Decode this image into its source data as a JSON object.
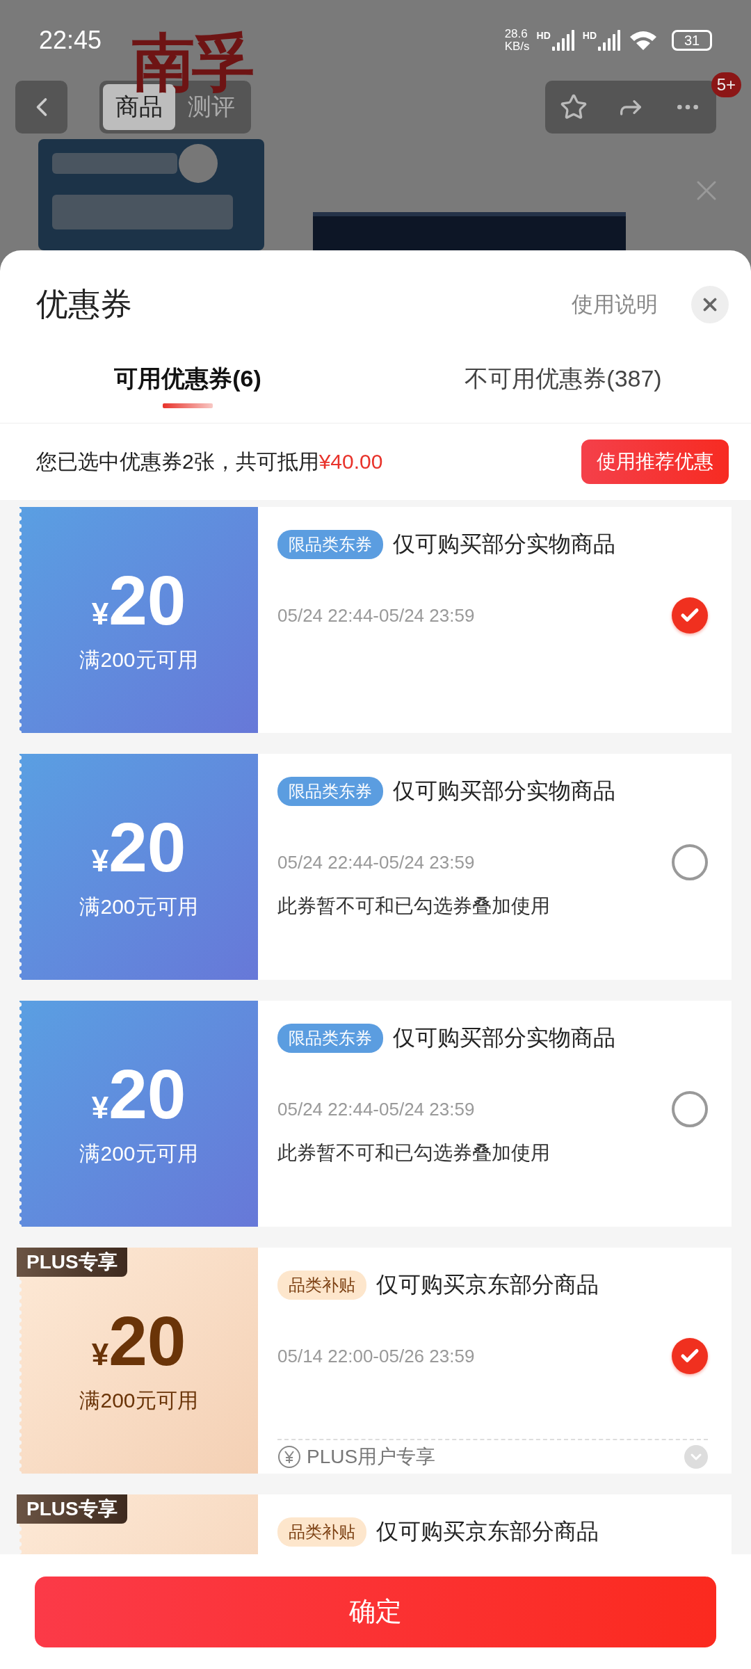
{
  "status_bar": {
    "time": "22:45",
    "net_speed": "28.6",
    "net_unit": "KB/s",
    "sim1": "HD",
    "sim2": "HD",
    "battery": "31"
  },
  "background_page": {
    "logo": "南孚",
    "tabs": [
      {
        "label": "商品",
        "selected": true
      },
      {
        "label": "测评",
        "selected": false
      }
    ],
    "badge": "5+"
  },
  "sheet": {
    "title": "优惠券",
    "help_link": "使用说明",
    "tabs": [
      {
        "label": "可用优惠券(6)",
        "selected": true
      },
      {
        "label": "不可用优惠券(387)",
        "selected": false
      }
    ],
    "summary": {
      "text": "您已选中优惠券2张，共可抵用",
      "amount": "¥40.00",
      "button": "使用推荐优惠"
    },
    "coupons": [
      {
        "kind": "blue",
        "currency": "¥",
        "amount": "20",
        "condition": "满200元可用",
        "tag": "限品类东券",
        "title": "仅可购买部分实物商品",
        "validity": "05/24 22:44-05/24 23:59",
        "selected": true
      },
      {
        "kind": "blue",
        "currency": "¥",
        "amount": "20",
        "condition": "满200元可用",
        "tag": "限品类东券",
        "title": "仅可购买部分实物商品",
        "validity": "05/24 22:44-05/24 23:59",
        "note": "此券暂不可和已勾选券叠加使用",
        "selected": false
      },
      {
        "kind": "blue",
        "currency": "¥",
        "amount": "20",
        "condition": "满200元可用",
        "tag": "限品类东券",
        "title": "仅可购买部分实物商品",
        "validity": "05/24 22:44-05/24 23:59",
        "note": "此券暂不可和已勾选券叠加使用",
        "selected": false
      },
      {
        "kind": "plus",
        "badge": "PLUS专享",
        "currency": "¥",
        "amount": "20",
        "condition": "满200元可用",
        "tag": "品类补贴",
        "title": "仅可购买京东部分商品",
        "validity": "05/14 22:00-05/26 23:59",
        "footer": "PLUS用户专享",
        "selected": true
      },
      {
        "kind": "plus",
        "badge": "PLUS专享",
        "tag": "品类补贴",
        "title": "仅可购买京东部分商品"
      }
    ],
    "confirm_button": "确定"
  }
}
